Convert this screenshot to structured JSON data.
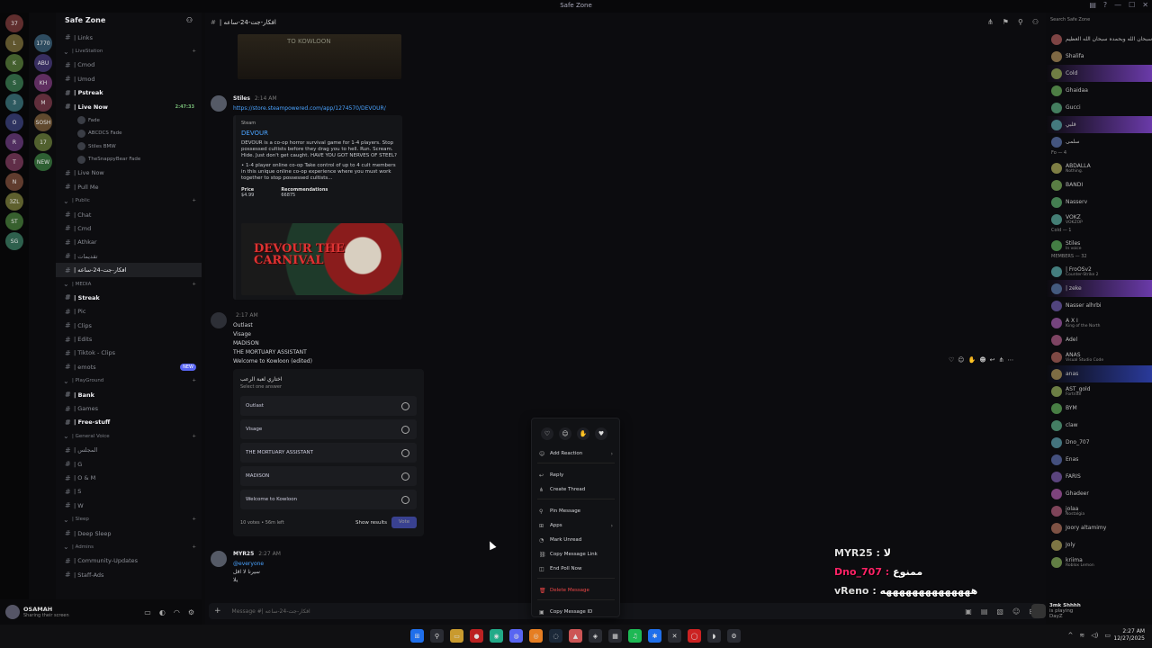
{
  "window": {
    "title": "Safe Zone"
  },
  "servers": [
    "37",
    "L",
    "K",
    "S",
    "3",
    "O",
    "R",
    "T",
    "N",
    "3ZL",
    "ST",
    "SG",
    "1770",
    "ABU",
    "KH",
    "M",
    "SOSH",
    "17",
    "NEW"
  ],
  "guild": {
    "name": "Safe Zone"
  },
  "channels": [
    {
      "type": "ch",
      "label": "| Links"
    },
    {
      "type": "cat",
      "label": "| LiveStation"
    },
    {
      "type": "ch",
      "label": "| Cmod"
    },
    {
      "type": "ch",
      "label": "| Umod"
    },
    {
      "type": "ch",
      "label": "| Pstreak",
      "bold": true
    },
    {
      "type": "ch",
      "label": "| Live Now",
      "bold": true,
      "right": "2:47:33"
    },
    {
      "type": "sub",
      "label": "Fade"
    },
    {
      "type": "sub",
      "label": "ABCDCS  Fade"
    },
    {
      "type": "sub",
      "label": "Stiles  BMW"
    },
    {
      "type": "sub",
      "label": "TheSnappyBear  Fade"
    },
    {
      "type": "ch",
      "label": "| Live Now"
    },
    {
      "type": "ch",
      "label": "| Pull Me"
    },
    {
      "type": "cat",
      "label": "| Public"
    },
    {
      "type": "ch",
      "label": "| Chat"
    },
    {
      "type": "ch",
      "label": "| Cmd"
    },
    {
      "type": "ch",
      "label": "| Athkar"
    },
    {
      "type": "ch",
      "label": "| تقديمات"
    },
    {
      "type": "ch",
      "label": "| افكار-جت-24-ساعه",
      "active": true
    },
    {
      "type": "cat",
      "label": "| MEDIA"
    },
    {
      "type": "ch",
      "label": "| Streak",
      "bold": true
    },
    {
      "type": "ch",
      "label": "| Pic"
    },
    {
      "type": "ch",
      "label": "| Clips"
    },
    {
      "type": "ch",
      "label": "| Edits"
    },
    {
      "type": "ch",
      "label": "| Tiktok - Clips"
    },
    {
      "type": "ch",
      "label": "| emots",
      "new": "NEW"
    },
    {
      "type": "cat",
      "label": "| PlayGround"
    },
    {
      "type": "ch",
      "label": "| Bank",
      "bold": true
    },
    {
      "type": "ch",
      "label": "| Games"
    },
    {
      "type": "ch",
      "label": "| Free-stuff",
      "bold": true
    },
    {
      "type": "cat",
      "label": "| General Voice"
    },
    {
      "type": "ch",
      "label": "| المجلس"
    },
    {
      "type": "ch",
      "label": "| G"
    },
    {
      "type": "ch",
      "label": "| O & M"
    },
    {
      "type": "ch",
      "label": "| S"
    },
    {
      "type": "ch",
      "label": "| W"
    },
    {
      "type": "cat",
      "label": "| Sleep"
    },
    {
      "type": "ch",
      "label": "| Deep Sleep"
    },
    {
      "type": "cat",
      "label": "| Admins"
    },
    {
      "type": "ch",
      "label": "| Community-Updates"
    },
    {
      "type": "ch",
      "label": "| Staff-Ads"
    }
  ],
  "user": {
    "name": "OSAMAH",
    "status": "Sharing their screen"
  },
  "chat": {
    "channel_name": "| افكار-جت-24-ساعه",
    "image_text": "TO KOWLOON",
    "msg1": {
      "author": "Stiles",
      "time": "2:14 AM",
      "link": "https://store.steampowered.com/app/1274570/DEVOUR/",
      "embed": {
        "provider": "Steam",
        "title": "DEVOUR",
        "desc": "DEVOUR is a co-op horror survival game for 1-4 players. Stop possessed cultists before they drag you to hell. Run. Scream. Hide. Just don't get caught. HAVE YOU GOT NERVES OF STEEL?",
        "bullet": "• 1-4 player online co-op  Take control of up to 4 cult members in this unique online co-op experience where you must work together to stop possessed cultists...",
        "price_label": "Price",
        "price": "$4.99",
        "rec_label": "Recommendations",
        "rec": "66875",
        "banner": "DEVOUR THE CARNIVAL"
      }
    },
    "msg2": {
      "author": "",
      "time": "2:17 AM",
      "lines": [
        "Outlast",
        "Visage",
        "MADISON",
        "THE MORTUARY ASSISTANT",
        "Welcome to Kowloon (edited)"
      ],
      "poll": {
        "question": "اختاري لعبة الرعب",
        "hint": "Select one answer",
        "options": [
          "Outlast",
          "Visage",
          "THE MORTUARY ASSISTANT",
          "MADISON",
          "Welcome to Kowloon"
        ],
        "votes": "10 votes",
        "time_left": "56m left",
        "show_results": "Show results",
        "vote": "Vote"
      }
    },
    "msg3": {
      "author": "MYR25",
      "time": "2:27 AM",
      "lines": [
        "@everyone",
        "سيرنا لا اقل",
        "يلا"
      ]
    },
    "composer_placeholder": "Message #| افكار-جت-24-ساعه"
  },
  "context_menu": {
    "items": [
      {
        "label": "Add Reaction",
        "arrow": true
      },
      {
        "label": "Reply"
      },
      {
        "label": "Create Thread"
      },
      {
        "label": "Pin Message"
      },
      {
        "label": "Apps",
        "arrow": true
      },
      {
        "label": "Mark Unread"
      },
      {
        "label": "Copy Message Link"
      },
      {
        "label": "End Poll Now"
      },
      {
        "label": "Delete Message",
        "danger": true
      },
      {
        "label": "Copy Message ID"
      }
    ]
  },
  "overlay": [
    {
      "user": "MYR25 :",
      "text": "لا"
    },
    {
      "user": "Dno_707 :",
      "text": "ممنوع"
    },
    {
      "user": "vReno :",
      "text": "ههههههههههههههه"
    }
  ],
  "members": {
    "search": "Search Safe Zone",
    "groups": [
      {
        "header": "",
        "items": [
          {
            "name": "سبحان الله وبحمده سبحان الله العظيم"
          },
          {
            "name": "Shalifa"
          },
          {
            "name": "Cold",
            "hl": true
          },
          {
            "name": "Ghaidaa"
          },
          {
            "name": "Gucci"
          },
          {
            "name": "قلبي",
            "hl": true
          },
          {
            "name": "سلمى"
          }
        ]
      },
      {
        "header": "Fo — 4",
        "items": [
          {
            "name": "ABDALLA",
            "act": "Nothing."
          },
          {
            "name": "BANDI"
          },
          {
            "name": "Nasserv"
          },
          {
            "name": "VOKZ",
            "act": "VOKZOP"
          }
        ]
      },
      {
        "header": "Cold — 1",
        "items": [
          {
            "name": "Stiles",
            "act": "In voice"
          }
        ]
      },
      {
        "header": "MEMBERS — 32",
        "items": [
          {
            "name": "| FroOSv2",
            "act": "Counter-Strike 2"
          },
          {
            "name": "| zeke",
            "hl": true
          },
          {
            "name": "Nasser alhrbi"
          },
          {
            "name": "A X I",
            "act": "King of the North"
          },
          {
            "name": "Adel"
          },
          {
            "name": "ANAS",
            "act": "Visual Studio Code"
          },
          {
            "name": "anas",
            "hl2": true
          },
          {
            "name": "AST_gold",
            "act": "Fortnite"
          },
          {
            "name": "BYM"
          },
          {
            "name": "claw"
          },
          {
            "name": "Dno_707"
          },
          {
            "name": "Enas"
          },
          {
            "name": "FARIS"
          },
          {
            "name": "Ghadeer"
          },
          {
            "name": "jolaa",
            "act": "Nostalgia"
          },
          {
            "name": "Joory altamimy"
          },
          {
            "name": "Joly"
          },
          {
            "name": "kriima",
            "act": "Roblox Lemon"
          }
        ]
      }
    ],
    "streamer": {
      "name": "3mk Shhhh",
      "act": "is playing",
      "game": "DayZ"
    }
  },
  "taskbar": {
    "time": "2:27 AM",
    "date": "12/27/2025"
  }
}
